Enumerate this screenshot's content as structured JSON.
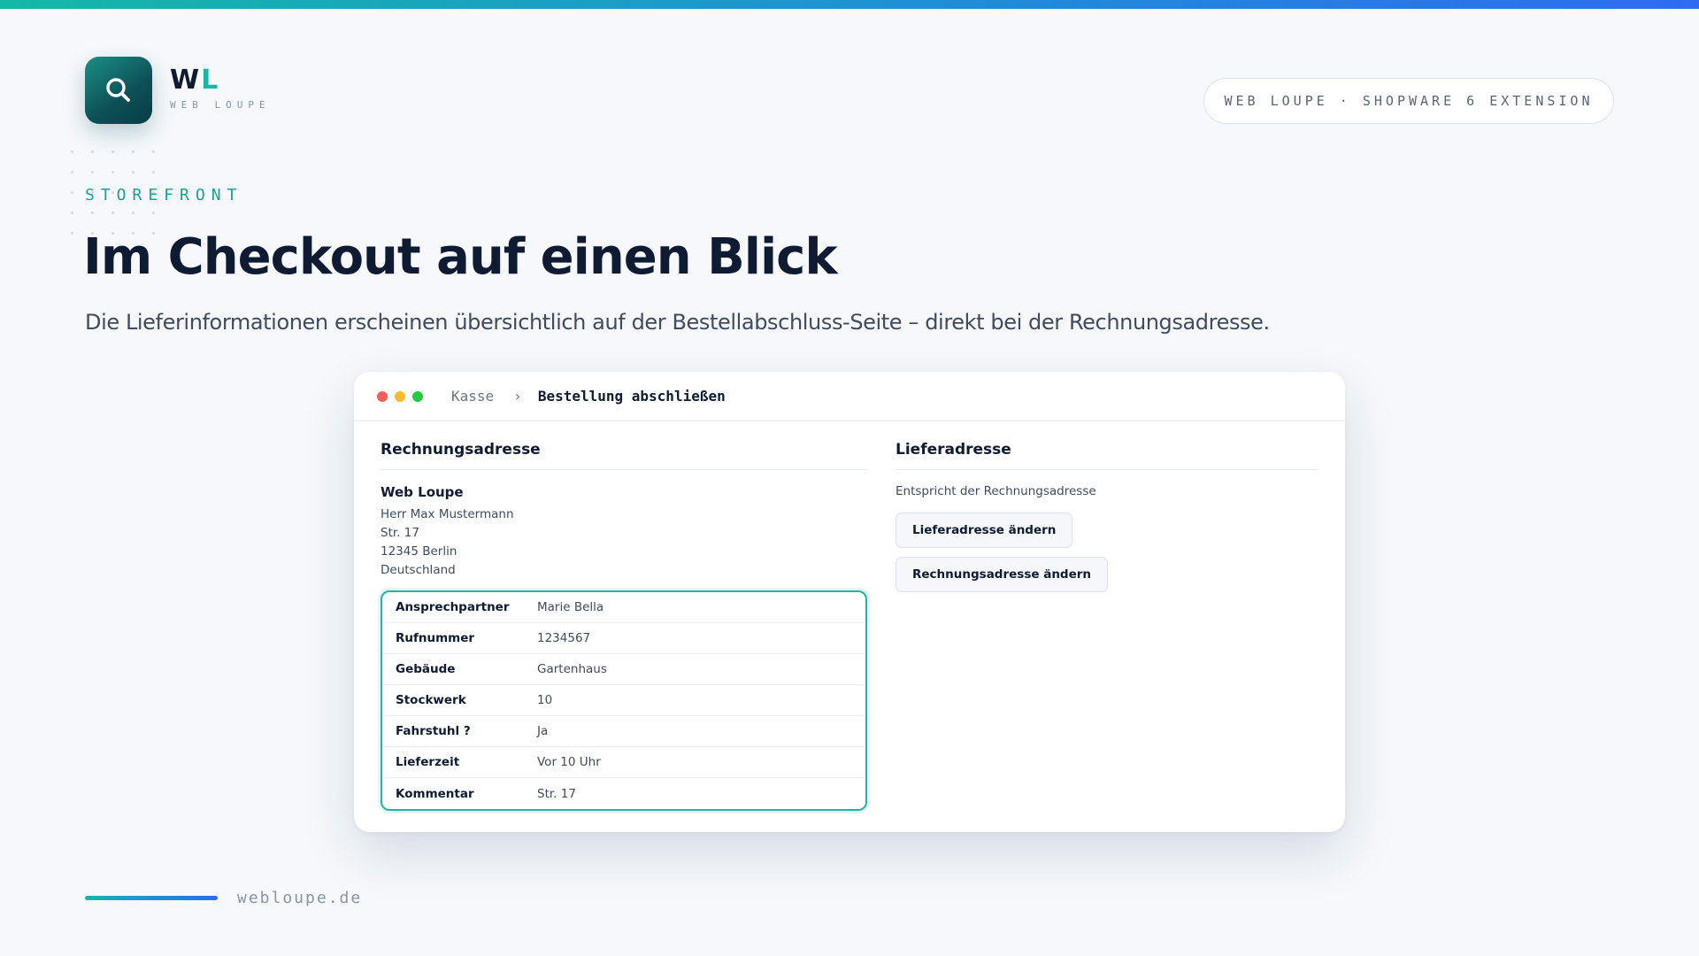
{
  "brand": {
    "logo_mark_main": "W",
    "logo_mark_accent": "L",
    "logo_sub": "WEB LOUPE",
    "icon": "search-icon",
    "accent_color": "#14b8a6",
    "dark_color": "#0f1b33"
  },
  "header_pill": "WEB LOUPE · SHOPWARE 6 EXTENSION",
  "eyebrow": "STOREFRONT",
  "headline": "Im Checkout auf einen Blick",
  "subline": "Die Lieferinformationen erscheinen übersichtlich auf der Bestellabschluss-Seite – direkt bei der Rechnungsadresse.",
  "window": {
    "breadcrumb_root": "Kasse",
    "breadcrumb_separator": "›",
    "breadcrumb_current": "Bestellung abschließen",
    "billing": {
      "title": "Rechnungsadresse",
      "company": "Web Loupe",
      "lines": [
        "Herr Max Mustermann",
        "Str. 17",
        "12345 Berlin",
        "Deutschland"
      ],
      "details": [
        {
          "label": "Ansprechpartner",
          "value": "Marie Bella"
        },
        {
          "label": "Rufnummer",
          "value": "1234567"
        },
        {
          "label": "Gebäude",
          "value": "Gartenhaus"
        },
        {
          "label": "Stockwerk",
          "value": "10"
        },
        {
          "label": "Fahrstuhl ?",
          "value": "Ja"
        },
        {
          "label": "Lieferzeit",
          "value": "Vor 10 Uhr"
        },
        {
          "label": "Kommentar",
          "value": "Str. 17"
        }
      ]
    },
    "shipping": {
      "title": "Lieferadresse",
      "note": "Entspricht der Rechnungsadresse",
      "change_shipping_label": "Lieferadresse ändern",
      "change_billing_label": "Rechnungsadresse ändern"
    }
  },
  "footer_url": "webloupe.de"
}
